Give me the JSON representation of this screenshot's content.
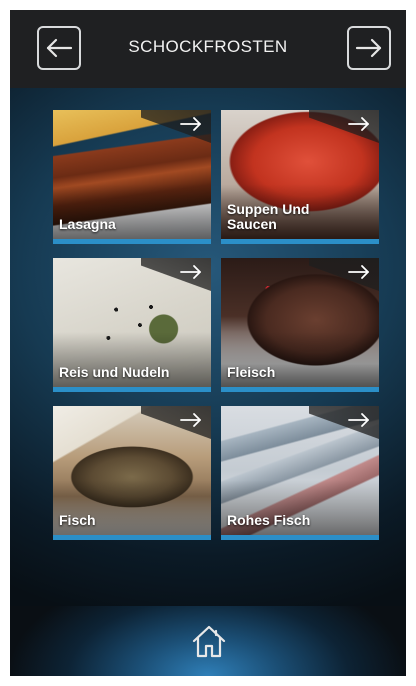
{
  "header": {
    "title": "SCHOCKFROSTEN",
    "back_icon": "arrow-left-icon",
    "forward_icon": "arrow-right-icon"
  },
  "tiles": [
    {
      "label": "Lasagna",
      "icon": "arrow-right-icon"
    },
    {
      "label": "Suppen Und Saucen",
      "icon": "arrow-right-icon"
    },
    {
      "label": "Reis und Nudeln",
      "icon": "arrow-right-icon"
    },
    {
      "label": "Fleisch",
      "icon": "arrow-right-icon"
    },
    {
      "label": "Fisch",
      "icon": "arrow-right-icon"
    },
    {
      "label": "Rohes Fisch",
      "icon": "arrow-right-icon"
    }
  ],
  "footer": {
    "home_icon": "home-icon"
  },
  "colors": {
    "accent": "#2b8fc8",
    "header_bg": "#1f2022",
    "text": "#f2f2f2"
  }
}
